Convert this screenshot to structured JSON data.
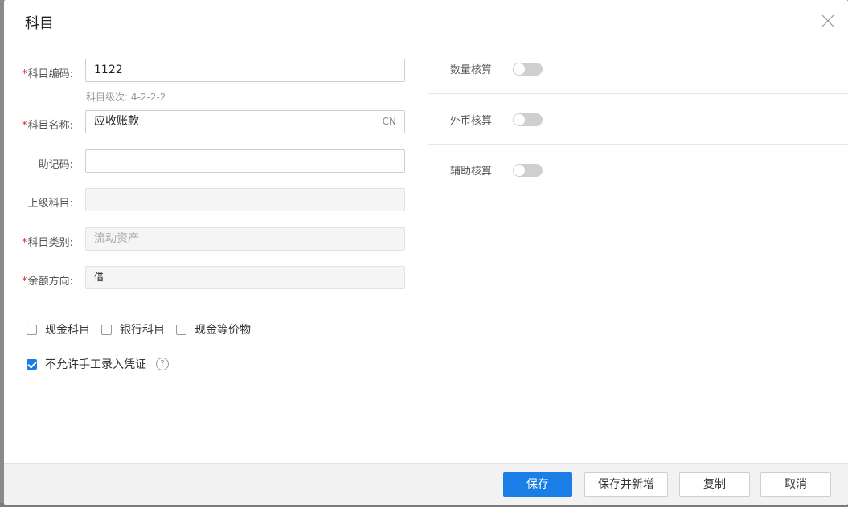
{
  "dialog": {
    "title": "科目",
    "close_icon": "close-icon"
  },
  "form": {
    "code": {
      "label": "科目编码:",
      "required": true,
      "value": "1122",
      "hint": "科目级次: 4-2-2-2"
    },
    "name": {
      "label": "科目名称:",
      "required": true,
      "value": "应收账款",
      "suffix": "CN"
    },
    "mnemonic": {
      "label": "助记码:",
      "required": false,
      "value": ""
    },
    "parent": {
      "label": "上级科目:",
      "required": false,
      "value": ""
    },
    "category": {
      "label": "科目类别:",
      "required": true,
      "value": "流动资产"
    },
    "balance_direction": {
      "label": "余额方向:",
      "required": true,
      "value": "借"
    }
  },
  "checkboxes": [
    {
      "label": "现金科目",
      "checked": false
    },
    {
      "label": "银行科目",
      "checked": false
    },
    {
      "label": "现金等价物",
      "checked": false
    }
  ],
  "manual_entry": {
    "label": "不允许手工录入凭证",
    "checked": true,
    "help_icon": "question-circle-icon",
    "help_glyph": "?"
  },
  "switches": [
    {
      "label": "数量核算",
      "on": false
    },
    {
      "label": "外币核算",
      "on": false
    },
    {
      "label": "辅助核算",
      "on": false
    }
  ],
  "footer": {
    "save": "保存",
    "save_and_new": "保存并新增",
    "copy": "复制",
    "cancel": "取消"
  },
  "required_mark": "*"
}
